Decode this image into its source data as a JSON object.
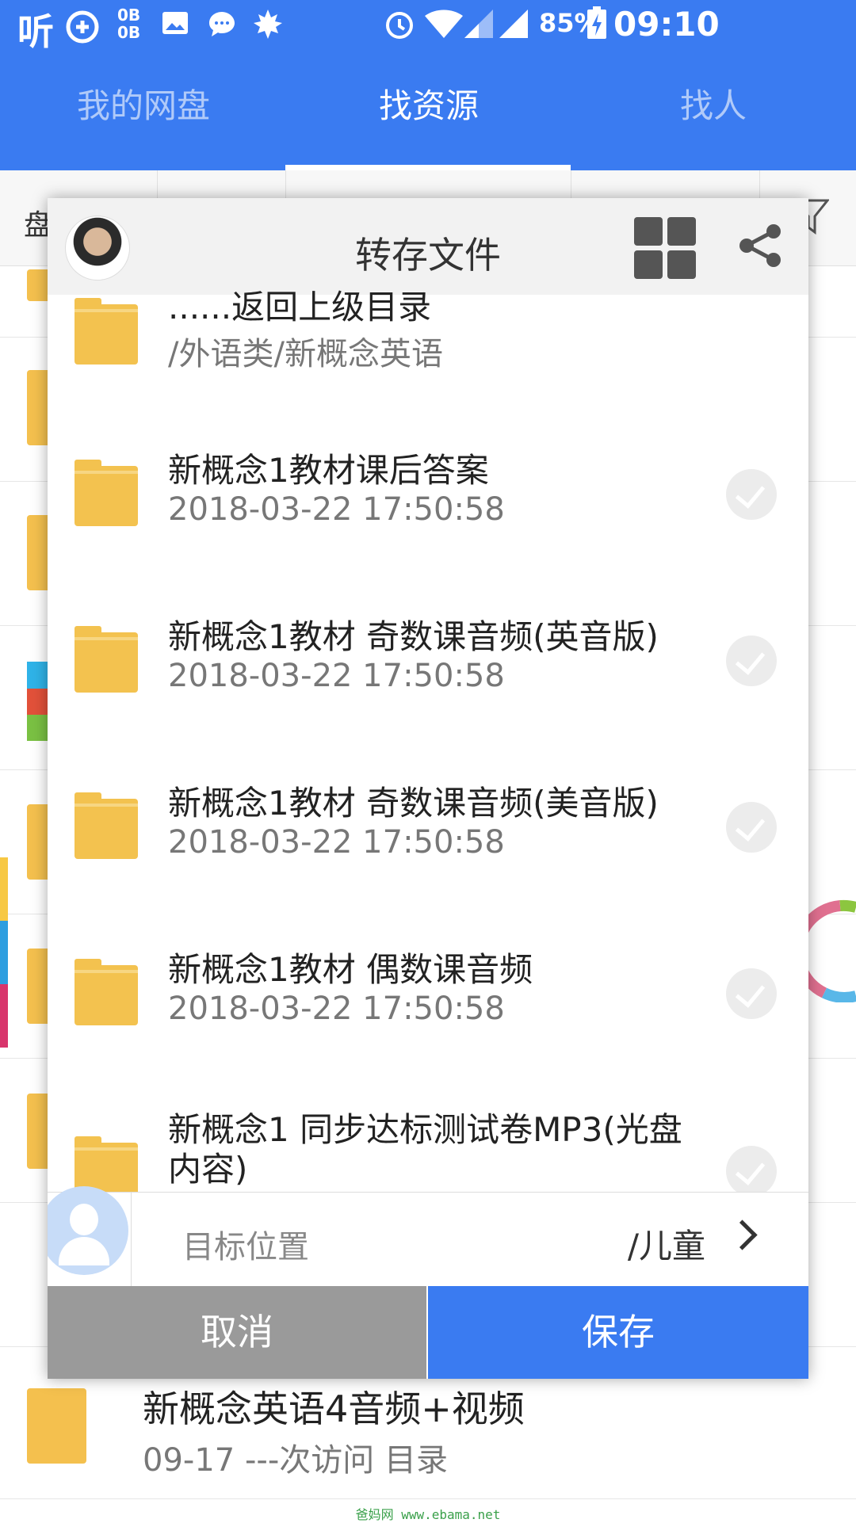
{
  "status_bar": {
    "battery": "85%",
    "time": "09:10",
    "data_rate_up": "0B",
    "data_rate_down": "0B"
  },
  "header": {
    "tabs": [
      {
        "label": "我的网盘"
      },
      {
        "label": "找资源"
      },
      {
        "label": "找人"
      }
    ]
  },
  "background_list": {
    "first_tab_partial": "盘",
    "bottom_item": {
      "name": "新概念英语4音频+视频",
      "meta": "09-17 ---次访问 目录"
    }
  },
  "dialog": {
    "title": "转存文件",
    "back_item": {
      "name": "......返回上级目录",
      "path": "/外语类/新概念英语"
    },
    "items": [
      {
        "name": "新概念1教材课后答案",
        "date": "2018-03-22 17:50:58"
      },
      {
        "name": "新概念1教材 奇数课音频(英音版)",
        "date": "2018-03-22 17:50:58"
      },
      {
        "name": "新概念1教材 奇数课音频(美音版)",
        "date": "2018-03-22 17:50:58"
      },
      {
        "name": "新概念1教材 偶数课音频",
        "date": "2018-03-22 17:50:58"
      },
      {
        "name": "新概念1 同步达标测试卷MP3(光盘",
        "name_line2": "内容)"
      }
    ],
    "target_label": "目标位置",
    "target_value": "/儿童",
    "cancel_label": "取消",
    "save_label": "保存"
  },
  "watermark": "爸妈网 www.ebama.net",
  "colors": {
    "primary": "#3a7bf1",
    "folder": "#f3c24f",
    "cancel": "#9a9a9a"
  }
}
